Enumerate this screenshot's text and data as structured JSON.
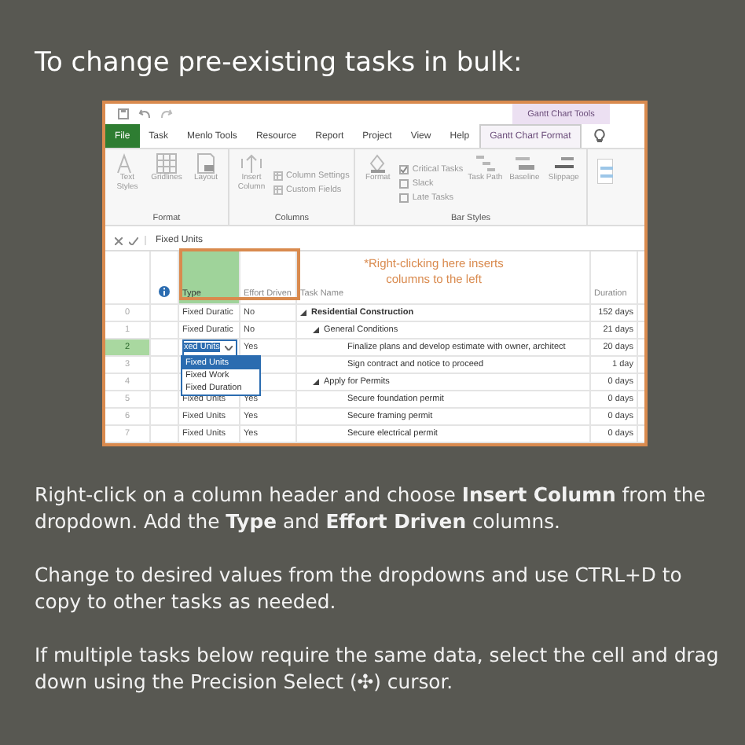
{
  "title": "To change pre-existing tasks in bulk:",
  "screenshot": {
    "context_group": "Gantt Chart Tools",
    "tabs": [
      {
        "label": "File",
        "kind": "file",
        "selected": false
      },
      {
        "label": "Task",
        "kind": "tab",
        "selected": false
      },
      {
        "label": "Menlo Tools",
        "kind": "tab",
        "selected": false
      },
      {
        "label": "Resource",
        "kind": "tab",
        "selected": false
      },
      {
        "label": "Report",
        "kind": "tab",
        "selected": false
      },
      {
        "label": "Project",
        "kind": "tab",
        "selected": false
      },
      {
        "label": "View",
        "kind": "tab",
        "selected": false
      },
      {
        "label": "Help",
        "kind": "tab",
        "selected": false
      },
      {
        "label": "Gantt Chart Format",
        "kind": "tab",
        "selected": true
      }
    ],
    "ribbon": [
      {
        "label": "Format",
        "items": [
          {
            "kind": "large",
            "label": "Text Styles"
          },
          {
            "kind": "large",
            "label": "Gridlines"
          },
          {
            "kind": "large",
            "label": "Layout"
          }
        ]
      },
      {
        "label": "Columns",
        "items": [
          {
            "kind": "large",
            "label": "Insert Column"
          },
          {
            "kind": "small",
            "label": "Column Settings"
          },
          {
            "kind": "small",
            "label": "Custom Fields"
          }
        ]
      },
      {
        "label": "Bar Styles",
        "items": [
          {
            "kind": "large",
            "label": "Format"
          },
          {
            "kind": "check",
            "label": "Critical Tasks",
            "checked": true
          },
          {
            "kind": "check",
            "label": "Slack",
            "checked": false
          },
          {
            "kind": "check",
            "label": "Late Tasks",
            "checked": false
          },
          {
            "kind": "large",
            "label": "Task Path"
          },
          {
            "kind": "large",
            "label": "Baseline"
          },
          {
            "kind": "large",
            "label": "Slippage"
          }
        ]
      }
    ],
    "formula_value": "Fixed Units",
    "columns": [
      {
        "label": "Type",
        "selected": true
      },
      {
        "label": "Effort Driven",
        "selected": false
      },
      {
        "label": "Task Name",
        "selected": false
      },
      {
        "label": "Duration",
        "selected": false
      }
    ],
    "callout": "*Right-clicking here inserts columns to the left",
    "tasks": [
      {
        "id": "0",
        "type": "Fixed Duratic",
        "effort": "No",
        "name": "Residential Construction",
        "duration": "152 days",
        "selected": false,
        "children": [
          {
            "id": "1",
            "type": "Fixed Duratic",
            "effort": "No",
            "name": "General Conditions",
            "duration": "21 days",
            "selected": false,
            "children": [
              {
                "id": "2",
                "type": "xed Units",
                "effort": "Yes",
                "name": "Finalize plans and develop estimate with owner, architect",
                "duration": "20 days",
                "selected": true
              },
              {
                "id": "3",
                "name": "Sign contract and notice to proceed",
                "duration": "1 day",
                "selected": false
              }
            ]
          },
          {
            "id": "4",
            "name": "Apply for Permits",
            "duration": "0 days",
            "selected": false,
            "children": [
              {
                "id": "5",
                "type": "Fixed Units",
                "effort": "Yes",
                "name": "Secure foundation permit",
                "duration": "0 days",
                "selected": false
              },
              {
                "id": "6",
                "type": "Fixed Units",
                "effort": "Yes",
                "name": "Secure framing permit",
                "duration": "0 days",
                "selected": false
              },
              {
                "id": "7",
                "type": "Fixed Units",
                "effort": "Yes",
                "name": "Secure electrical permit",
                "duration": "0 days",
                "selected": false
              }
            ]
          }
        ]
      }
    ],
    "dropdown": [
      {
        "label": "Fixed Units",
        "selected": true
      },
      {
        "label": "Fixed Work",
        "selected": false
      },
      {
        "label": "Fixed Duration",
        "selected": false
      }
    ]
  },
  "paragraphs": [
    "Right-click on a column header and choose **Insert Column** from the dropdown. Add the **Type** and **Effort Driven** columns.",
    "Change to desired values from the dropdowns and use CTRL+D to copy to other tasks as needed.",
    "If multiple tasks below require the same data, select the cell and drag down using the Precision Select (✣) cursor."
  ]
}
